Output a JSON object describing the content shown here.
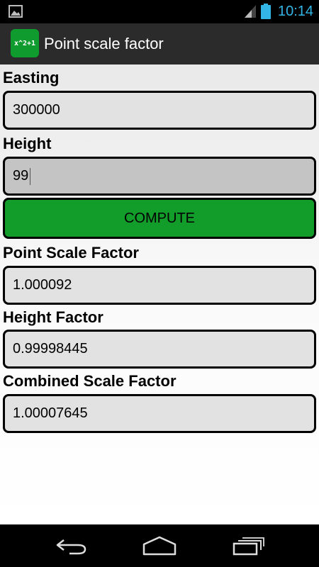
{
  "status_bar": {
    "time": "10:14",
    "accent_color": "#33b5e5",
    "icons": [
      "gallery-icon",
      "signal-icon",
      "battery-icon"
    ]
  },
  "action_bar": {
    "icon_text": "x^2+1",
    "title": "Point scale factor",
    "icon_color": "#109b2f"
  },
  "form": {
    "easting_label": "Easting",
    "easting_value": "300000",
    "height_label": "Height",
    "height_value": "99",
    "compute_label": "COMPUTE",
    "compute_color": "#129c2a"
  },
  "results": {
    "point_scale_factor_label": "Point Scale Factor",
    "point_scale_factor_value": "1.000092",
    "height_factor_label": "Height Factor",
    "height_factor_value": "0.99998445",
    "combined_scale_factor_label": "Combined Scale Factor",
    "combined_scale_factor_value": "1.00007645"
  },
  "nav_bar": {
    "icons": [
      "back-icon",
      "home-icon",
      "recent-apps-icon"
    ]
  }
}
